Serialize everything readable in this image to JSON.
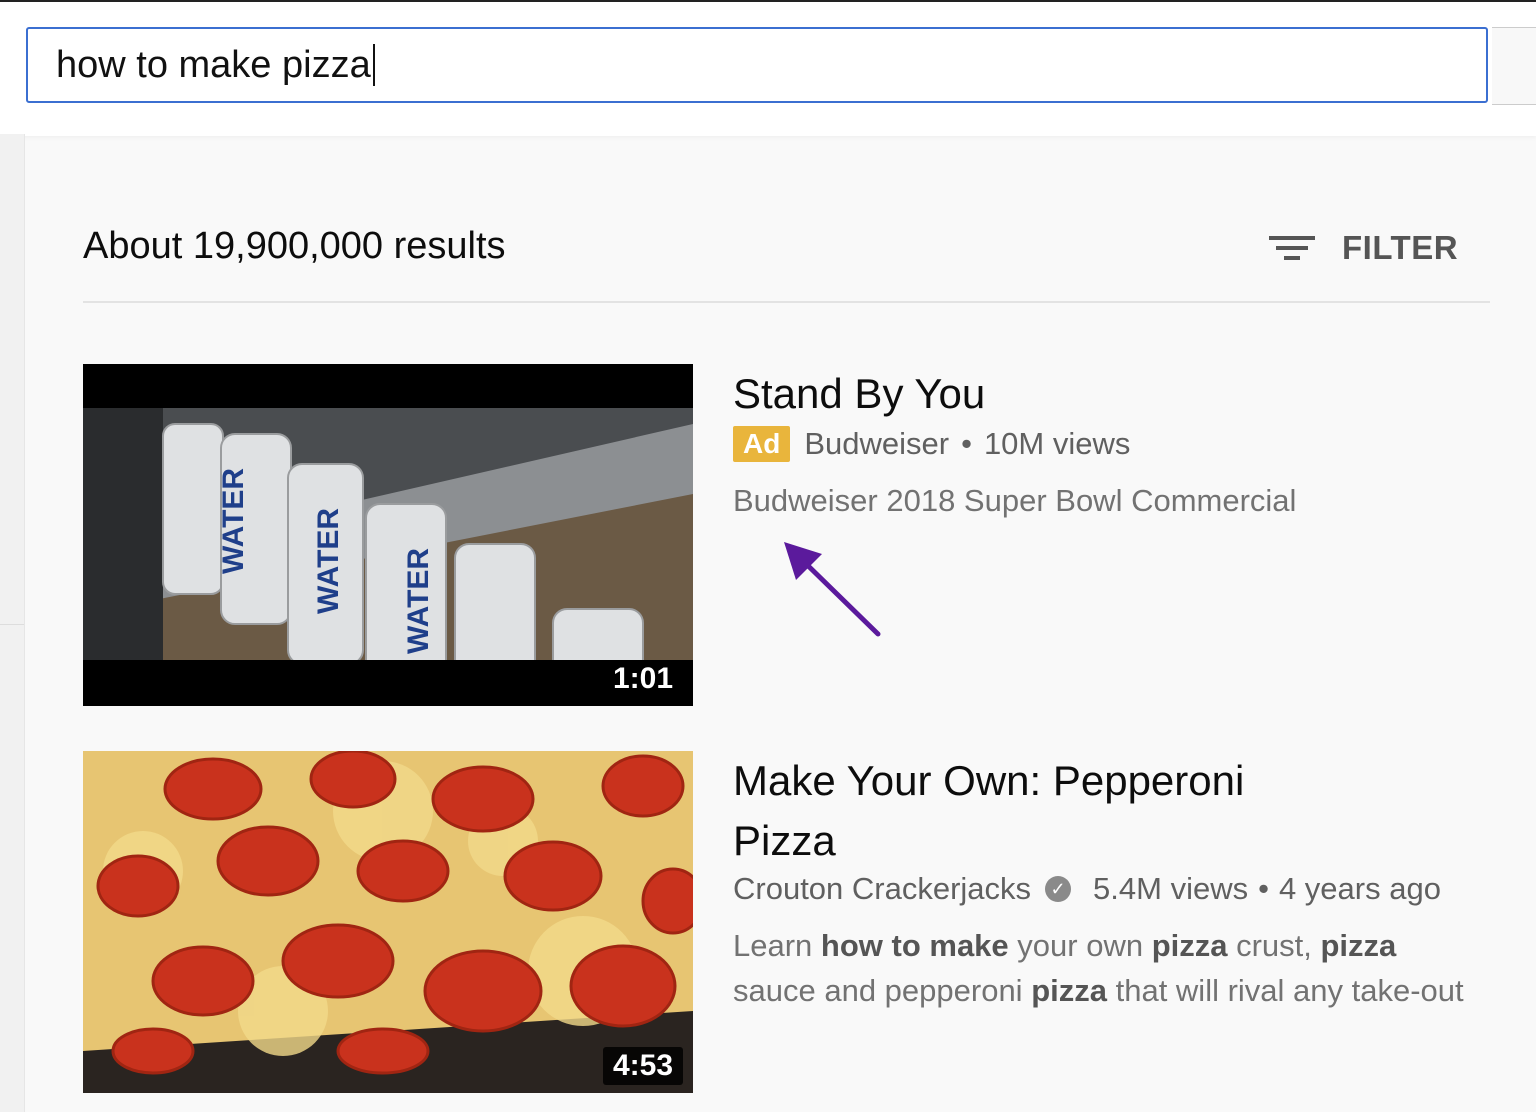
{
  "search": {
    "query": "how to make pizza"
  },
  "results_header": {
    "count_text": "About 19,900,000 results",
    "filter_label": "FILTER"
  },
  "videos": [
    {
      "title": "Stand By You",
      "ad_badge": "Ad",
      "channel": "Budweiser",
      "separator": "•",
      "views": "10M views",
      "description": "Budweiser 2018 Super Bowl Commercial",
      "duration": "1:01"
    },
    {
      "title_line1": "Make Your Own: Pepperoni",
      "title_line2": "Pizza",
      "channel": "Crouton Crackerjacks",
      "verified_icon": "✓",
      "views": "5.4M views",
      "separator": "•",
      "age": "4 years ago",
      "description_parts": [
        "Learn ",
        "how to make",
        " your own ",
        "pizza",
        " crust, ",
        "pizza"
      ],
      "description_line2_parts": [
        "sauce and pepperoni ",
        "pizza",
        " that will rival any take-out"
      ],
      "duration": "4:53"
    }
  ],
  "colors": {
    "accent_blue": "#3b6fd1",
    "ad_yellow": "#e9b53c",
    "arrow_purple": "#5b1a9c"
  }
}
